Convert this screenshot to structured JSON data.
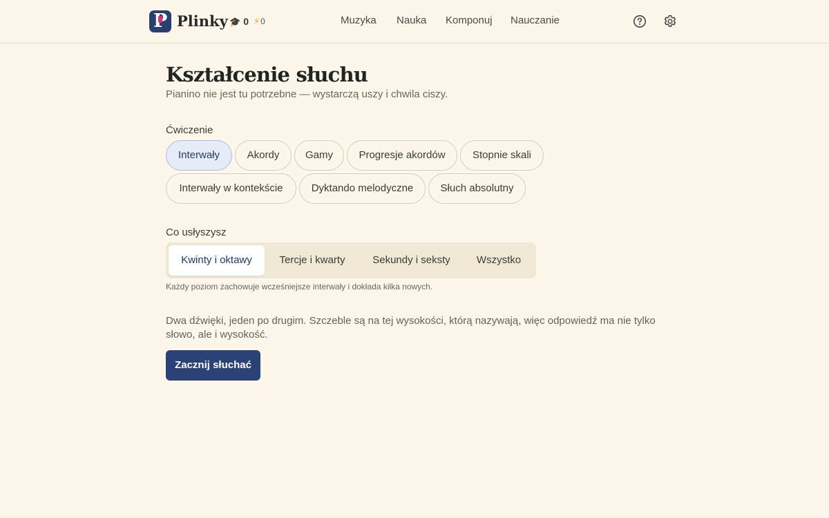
{
  "header": {
    "brand": "Plinky",
    "logo_letter": "P",
    "stats": {
      "grad_count": "0",
      "bolt_count": "0"
    },
    "nav": [
      "Muzyka",
      "Nauka",
      "Komponuj",
      "Nauczanie"
    ],
    "icons": [
      "help-circle-icon",
      "gear-icon"
    ]
  },
  "main": {
    "title": "Kształcenie słuchu",
    "subtitle": "Pianino nie jest tu potrzebne — wystarczą uszy i chwila ciszy.",
    "exercise_label": "Ćwiczenie",
    "exercises": [
      "Interwały",
      "Akordy",
      "Gamy",
      "Progresje akordów",
      "Stopnie skali",
      "Interwały w kontekście",
      "Dyktando melodyczne",
      "Słuch absolutny"
    ],
    "exercise_selected": "Interwały",
    "hear_label": "Co usłyszysz",
    "levels": [
      "Kwinty i oktawy",
      "Tercje i kwarty",
      "Sekundy i seksty",
      "Wszystko"
    ],
    "level_selected": "Kwinty i oktawy",
    "level_hint": "Każdy poziom zachowuje wcześniejsze interwały i dokłada kilka nowych.",
    "description": "Dwa dźwięki, jeden po drugim. Szczeble są na tej wysokości, którą nazywają, więc odpowiedź ma nie tylko słowo, ale i wysokość.",
    "start_button": "Zacznij słuchać"
  },
  "colors": {
    "background": "#fcf7ea",
    "accent": "#2a4275",
    "logo_pink": "#d8336f",
    "chip_active_bg": "#e7edf8"
  }
}
